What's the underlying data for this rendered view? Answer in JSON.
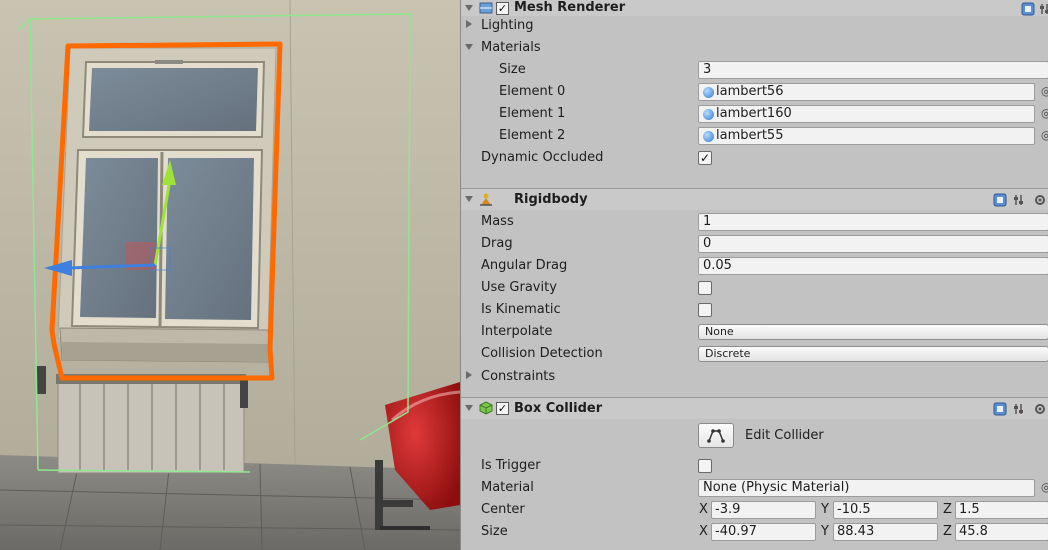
{
  "inspector": {
    "mesh_renderer": {
      "title": "Mesh Renderer",
      "enabled": true,
      "lighting_label": "Lighting",
      "materials_label": "Materials",
      "size_label": "Size",
      "size_value": "3",
      "elements": [
        {
          "label": "Element 0",
          "value": "lambert56"
        },
        {
          "label": "Element 1",
          "value": "lambert160"
        },
        {
          "label": "Element 2",
          "value": "lambert55"
        }
      ],
      "dynamic_occluded_label": "Dynamic Occluded",
      "dynamic_occluded": true
    },
    "rigidbody": {
      "title": "Rigidbody",
      "mass_label": "Mass",
      "mass_value": "1",
      "drag_label": "Drag",
      "drag_value": "0",
      "angular_drag_label": "Angular Drag",
      "angular_drag_value": "0.05",
      "use_gravity_label": "Use Gravity",
      "use_gravity": false,
      "is_kinematic_label": "Is Kinematic",
      "is_kinematic": false,
      "interpolate_label": "Interpolate",
      "interpolate_value": "None",
      "collision_label": "Collision Detection",
      "collision_value": "Discrete",
      "constraints_label": "Constraints"
    },
    "box_collider": {
      "title": "Box Collider",
      "enabled": true,
      "edit_collider_label": "Edit Collider",
      "is_trigger_label": "Is Trigger",
      "is_trigger": false,
      "material_label": "Material",
      "material_value": "None (Physic Material)",
      "center_label": "Center",
      "center": {
        "x": "-3.9",
        "y": "-10.5",
        "z": "1.5"
      },
      "size_label": "Size",
      "size": {
        "x": "-40.97",
        "y": "88.43",
        "z": "45.8"
      },
      "axis_labels": {
        "x": "X",
        "y": "Y",
        "z": "Z"
      }
    },
    "check_mark": "✓"
  },
  "colors": {
    "selection_outline": "#ff6a00",
    "bounds_wire": "#8ee88e",
    "gizmo_y": "#9ee23a",
    "gizmo_x": "#3f7fe0",
    "chair_red": "#c01818"
  },
  "icons": {
    "mesh_renderer": "mesh-renderer-icon",
    "rigidbody": "rigidbody-icon",
    "box_collider": "box-collider-icon",
    "help": "help-book-icon",
    "settings": "gear-icon",
    "edit_collider": "edit-collider-icon"
  }
}
